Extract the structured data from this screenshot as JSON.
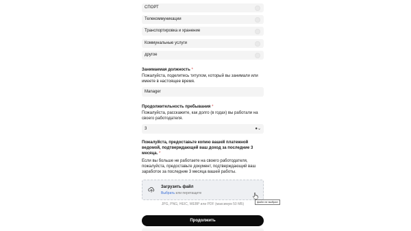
{
  "industry_options": [
    "СПОРТ",
    "Телекоммуникации",
    "Транспортировка и хранение",
    "Коммунальные услуги",
    "другое"
  ],
  "position_question": {
    "title": "Занимаемая должность",
    "required_mark": "*",
    "description": "Пожалуйста, поделитесь титулом, который вы занимали или имеете в настоящее время.",
    "value": "Manager"
  },
  "duration_question": {
    "title": "Продолжительность пребывания",
    "required_mark": "*",
    "description": "Пожалуйста, расскажите, как долго (в годах) вы работали на своего работодателя.",
    "value": "3"
  },
  "payslip_question": {
    "title": "Пожалуйста, предоставьте копию вашей платежной ведомой, подтверждающей ваш доход за последние 3 месяца.",
    "required_mark": "*",
    "description": "Если вы больше не работаете на своего работодателя, пожалуйста, предоставьте документ, подтверждающий ваш заработок за последние 3 месяца вашей работы."
  },
  "upload": {
    "title": "Загрузить файл",
    "choose_link": "Выбрать",
    "or_drag": "или перетащите",
    "formats_hint": "JPG, PNG, HEIC, WEBP или PDF (максимум 50 МБ)",
    "tooltip": "файл не выбран"
  },
  "submit_label": "Продолжить",
  "icons": {
    "radio": "radio-circle",
    "clear": "clear-circle-icon",
    "dropdown": "chevron-down-icon",
    "upload": "cloud-upload-icon",
    "cursor": "hand-pointer-icon"
  },
  "colors": {
    "button_bg": "#0b0b0b",
    "field_bg": "#f4f4f4",
    "link": "#3b6fd6",
    "required": "#d23b3b"
  }
}
